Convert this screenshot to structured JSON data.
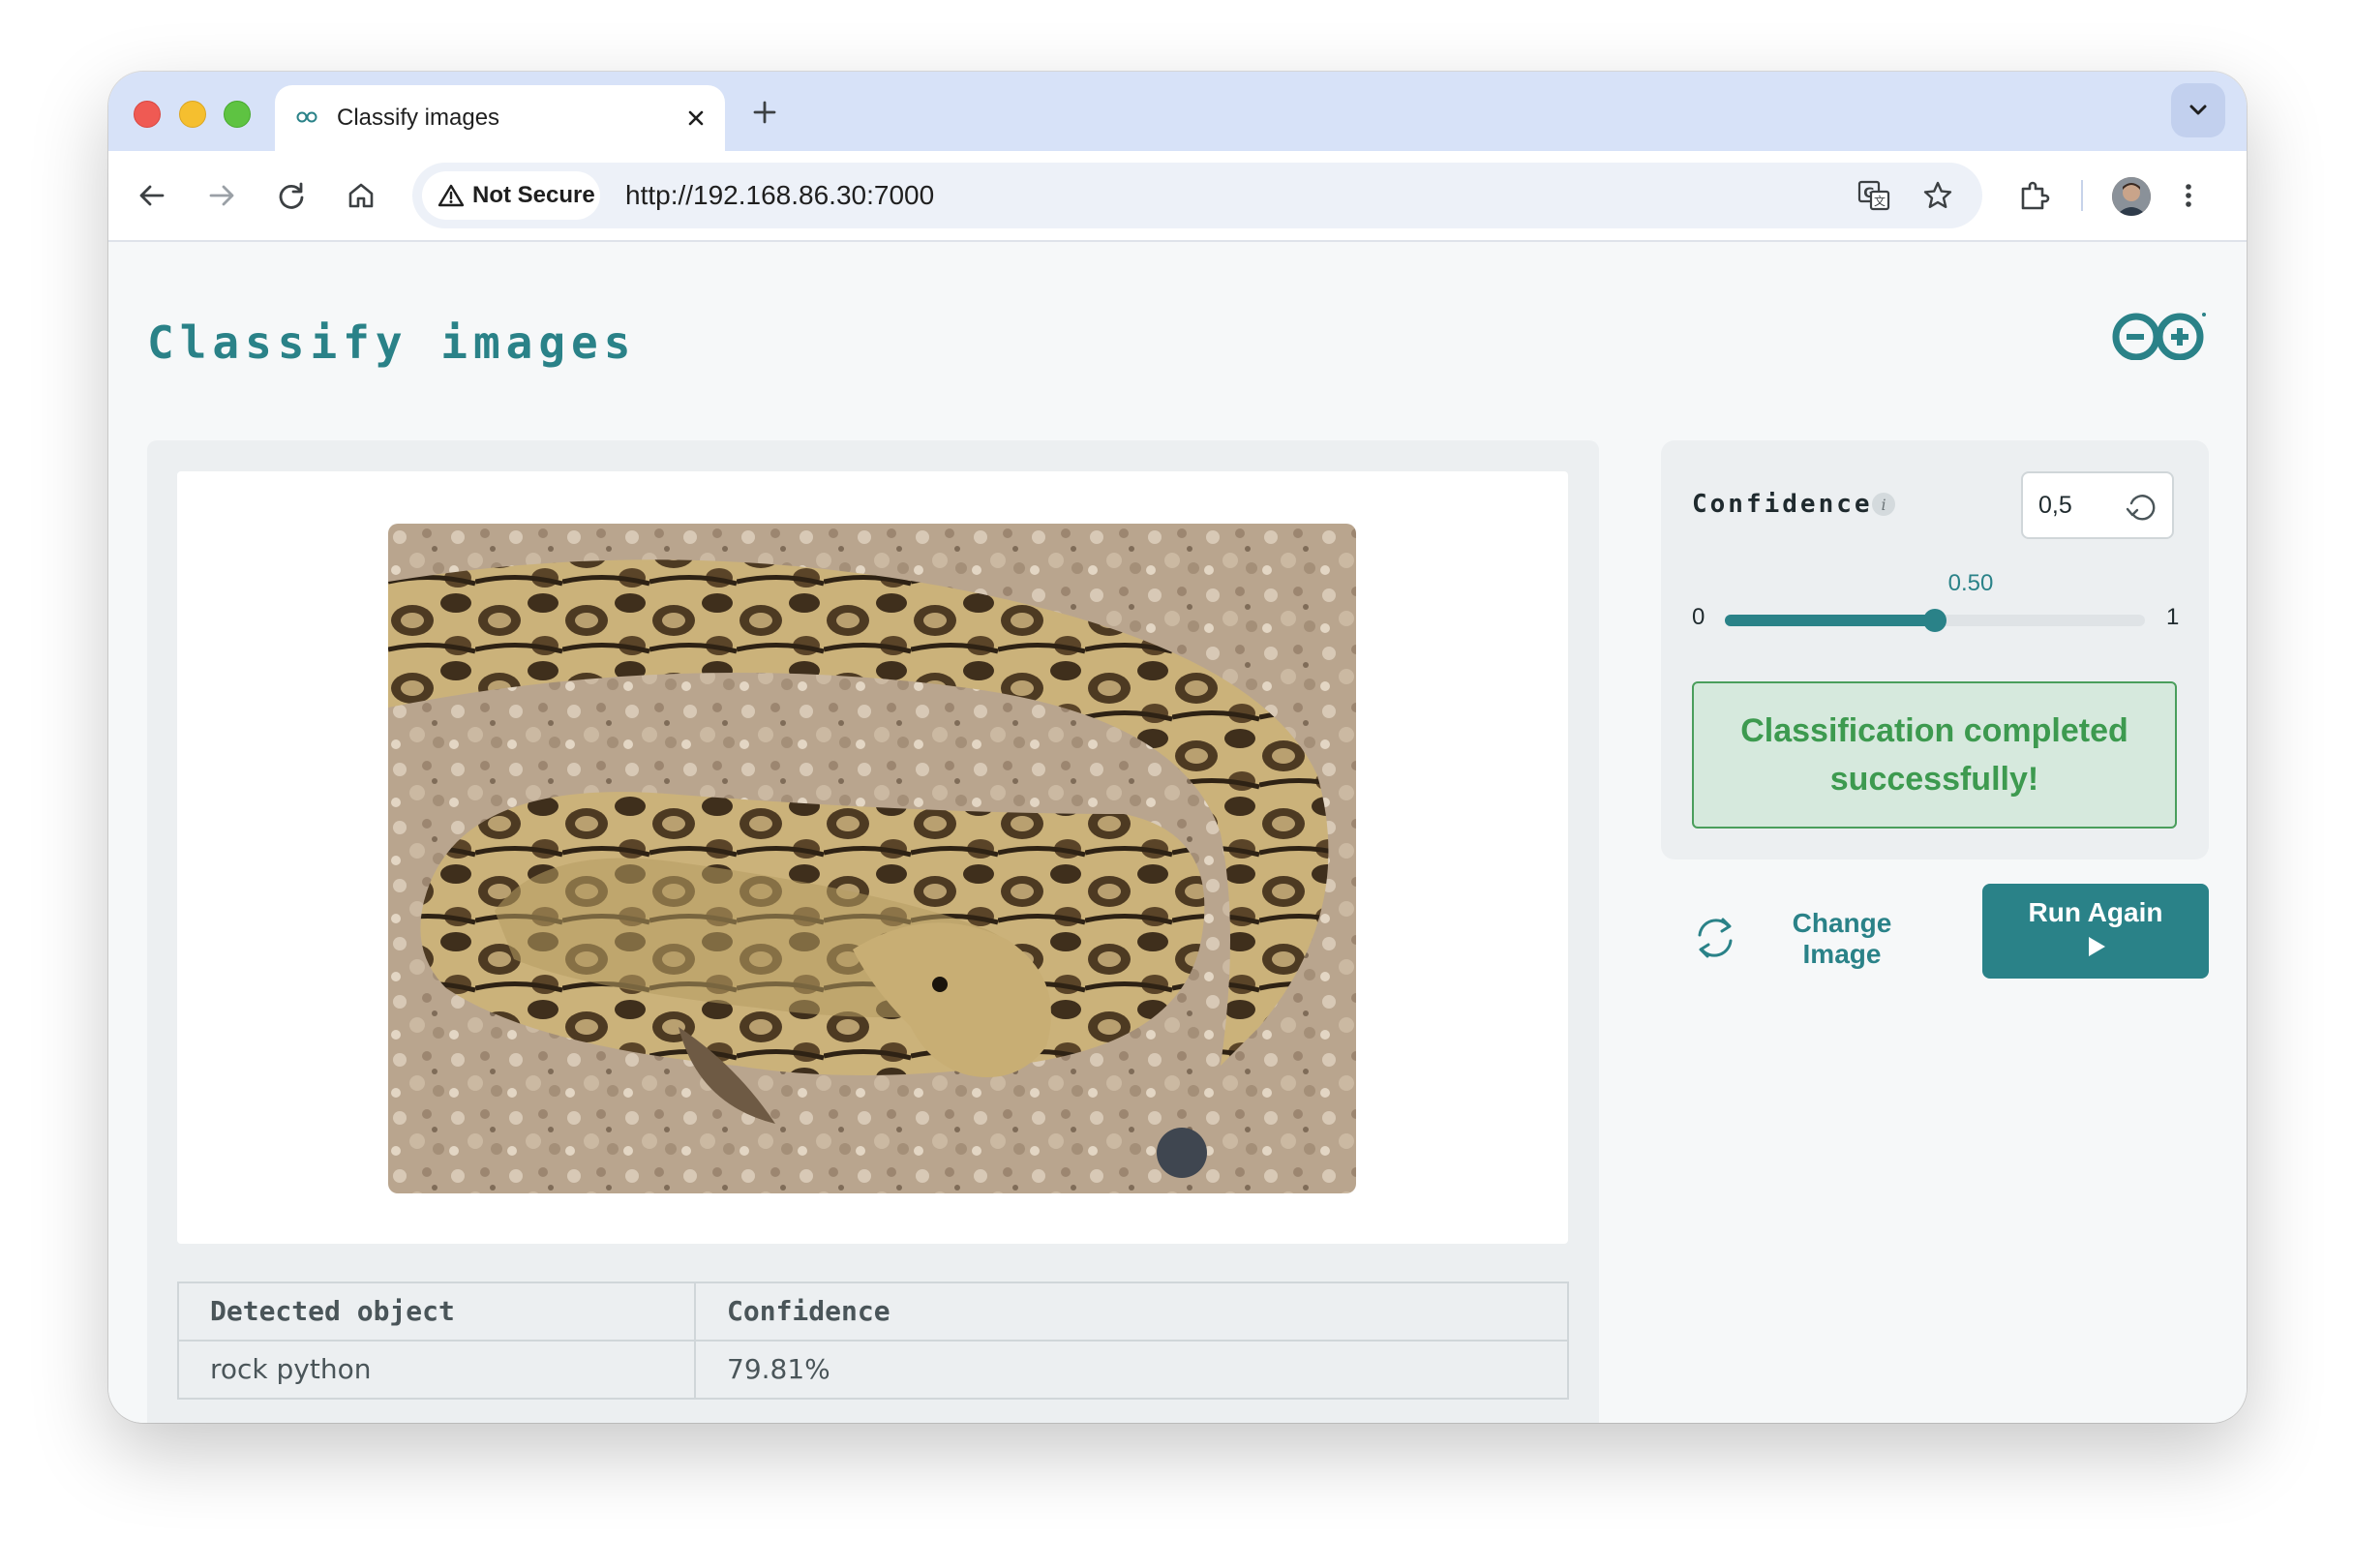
{
  "browser": {
    "tab_title": "Classify images",
    "security_chip": "Not Secure",
    "url": "http://192.168.86.30:7000"
  },
  "page": {
    "title": "Classify images",
    "image_alt": "snake photo",
    "results": {
      "headers": [
        "Detected object",
        "Confidence"
      ],
      "rows": [
        [
          "rock python",
          "79.81%"
        ]
      ]
    }
  },
  "controls": {
    "confidence_label": "Confidence",
    "confidence_input": "0,5",
    "slider": {
      "min": "0",
      "max": "1",
      "value_label": "0.50",
      "value": 0.5
    },
    "status_message": "Classification completed successfully!",
    "change_image_label": "Change Image",
    "run_again_label": "Run Again"
  },
  "colors": {
    "accent": "#2a8288",
    "success_bg": "#d6e9dd",
    "success_text": "#3d9a4f"
  },
  "icons": [
    "back-icon",
    "forward-icon",
    "reload-icon",
    "home-icon",
    "warning-icon",
    "translate-icon",
    "star-icon",
    "extensions-icon",
    "menu-dots-icon",
    "info-icon",
    "reset-icon",
    "refresh-icon",
    "play-icon",
    "arduino-logo-icon"
  ]
}
